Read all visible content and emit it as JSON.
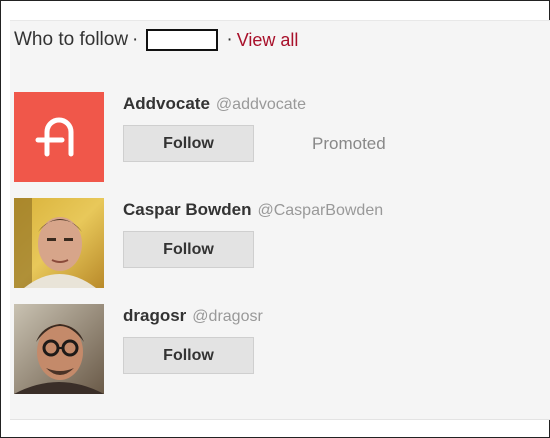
{
  "widget": {
    "title": "Who to follow",
    "separator": "·",
    "view_all_label": "View all"
  },
  "users": [
    {
      "name": "Addvocate",
      "handle": "@addvocate",
      "follow_label": "Follow",
      "promoted_label": "Promoted",
      "avatar_color": "#f0574a"
    },
    {
      "name": "Caspar Bowden",
      "handle": "@CasparBowden",
      "follow_label": "Follow"
    },
    {
      "name": "dragosr",
      "handle": "@dragosr",
      "follow_label": "Follow"
    }
  ]
}
